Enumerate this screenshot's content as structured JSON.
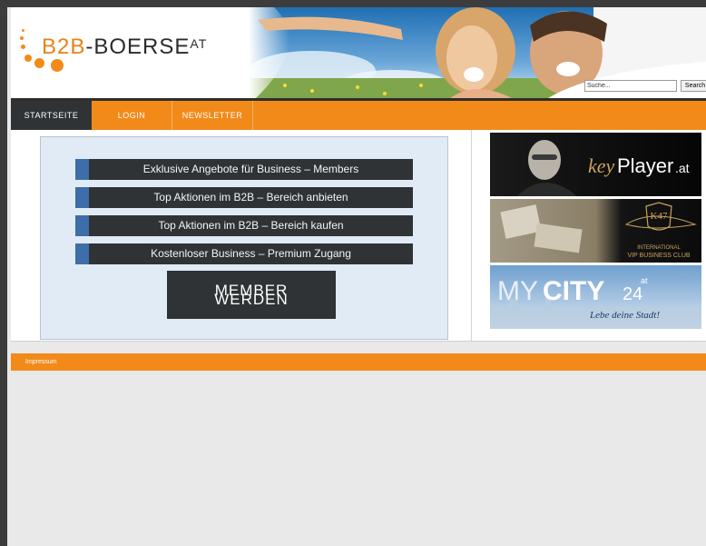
{
  "header": {
    "logo": {
      "part1": "B2B",
      "part2": "-BOERSE",
      "suffix": "AT"
    },
    "search": {
      "value": "Suche...",
      "button_label": "Search"
    }
  },
  "nav": {
    "items": [
      {
        "label": "STARTSEITE",
        "active": true
      },
      {
        "label": "LOGIN"
      },
      {
        "label": "NEWSLETTER"
      }
    ]
  },
  "main": {
    "offers": [
      "Exklusive Angebote für Business – Members",
      "Top Aktionen im B2B – Bereich anbieten",
      "Top Aktionen im B2B – Bereich kaufen",
      "Kostenloser Business – Premium Zugang"
    ],
    "member_button": {
      "line1": "MEMBER",
      "line2": "WERDEN"
    }
  },
  "banners": {
    "keyplayer": {
      "word1": "key",
      "word2": "Player",
      "suffix": ".at"
    },
    "k47": {
      "mark": "K47",
      "line1": "INTERNATIONAL",
      "line2": "VIP BUSINESS CLUB"
    },
    "mycity": {
      "word1": "MY",
      "word2": "CITY",
      "num": "24",
      "suffix": "at",
      "tagline": "Lebe deine Stadt!"
    }
  },
  "footer": {
    "link": "Impressum"
  },
  "colors": {
    "orange": "#f28a1a",
    "dark": "#2f3336",
    "blue_stripe": "#3d6eaa",
    "panel": "#e1ebf5"
  }
}
